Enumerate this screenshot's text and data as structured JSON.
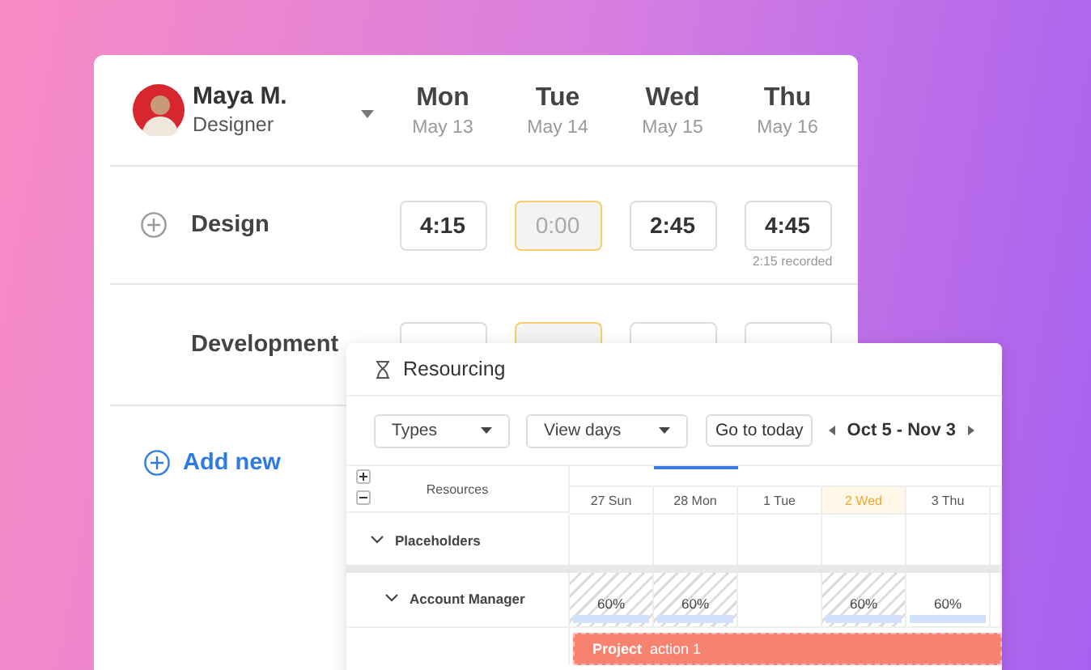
{
  "timesheet": {
    "user": {
      "name": "Maya M.",
      "role": "Designer"
    },
    "days": [
      {
        "day": "Mon",
        "date": "May 13"
      },
      {
        "day": "Tue",
        "date": "May 14"
      },
      {
        "day": "Wed",
        "date": "May 15"
      },
      {
        "day": "Thu",
        "date": "May 16"
      }
    ],
    "rows": [
      {
        "label": "Design",
        "show_add": true,
        "entries": [
          {
            "value": "4:15",
            "empty": false
          },
          {
            "placeholder": "0:00",
            "empty": true
          },
          {
            "value": "2:45",
            "empty": false
          },
          {
            "value": "4:45",
            "empty": false,
            "note": "2:15 recorded"
          }
        ]
      },
      {
        "label": "Development",
        "show_add": false,
        "entries": [
          {
            "empty": false
          },
          {
            "empty": true
          },
          {
            "empty": false
          },
          {
            "empty": false
          }
        ]
      }
    ],
    "add_new": "Add new"
  },
  "resourcing": {
    "title": "Resourcing",
    "filters": [
      "Types",
      "View days"
    ],
    "today_button": "Go to today",
    "range": "Oct 5 - Nov 3",
    "resources_label": "Resources",
    "days": [
      {
        "label": "27 Sun",
        "today": false,
        "highlighted": false
      },
      {
        "label": "28 Mon",
        "today": true,
        "highlighted": false
      },
      {
        "label": "1 Tue",
        "today": false,
        "highlighted": false
      },
      {
        "label": "2 Wed",
        "today": false,
        "highlighted": true
      },
      {
        "label": "3 Thu",
        "today": false,
        "highlighted": false
      }
    ],
    "groups": [
      {
        "name": "Placeholders",
        "kind": "group",
        "expanded": true,
        "cells": [
          {
            "hatched": false
          },
          {
            "hatched": false
          },
          {
            "hatched": false
          },
          {
            "hatched": false
          },
          {
            "hatched": false
          }
        ]
      },
      {
        "name": "Account Manager",
        "kind": "role",
        "expanded": true,
        "cells": [
          {
            "hatched": true,
            "load": "60%"
          },
          {
            "hatched": true,
            "load": "60%"
          },
          {
            "hatched": false
          },
          {
            "hatched": true,
            "load": "60%"
          },
          {
            "hatched": false,
            "load": "60%"
          }
        ]
      }
    ],
    "bars": [
      {
        "project": "Project",
        "task": "action 1"
      }
    ]
  }
}
